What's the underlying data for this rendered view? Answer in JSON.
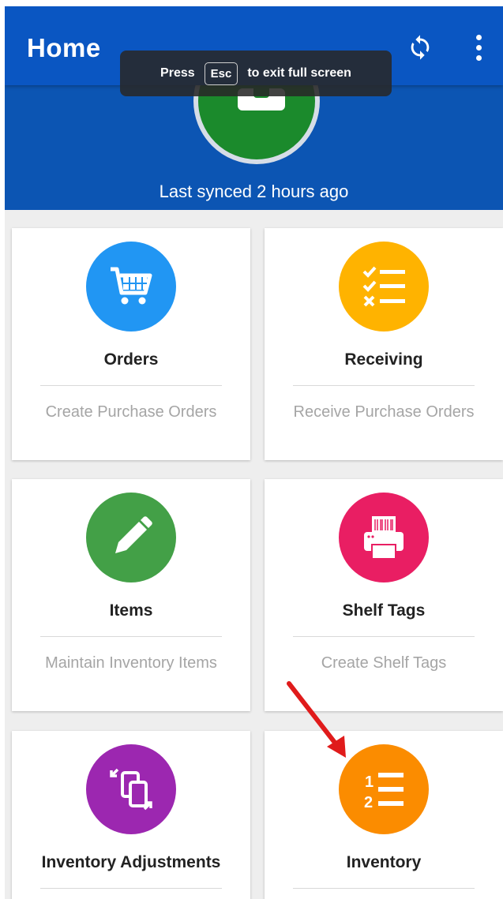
{
  "app": {
    "title": "Home",
    "sync_status": "Last synced 2 hours ago"
  },
  "toast": {
    "prefix": "Press",
    "key": "Esc",
    "suffix": "to exit full screen"
  },
  "tiles": [
    {
      "title": "Orders",
      "subtitle": "Create Purchase Orders",
      "icon": "cart-icon",
      "color": "#2196f3"
    },
    {
      "title": "Receiving",
      "subtitle": "Receive Purchase Orders",
      "icon": "checklist-icon",
      "color": "#ffb300"
    },
    {
      "title": "Items",
      "subtitle": "Maintain Inventory Items",
      "icon": "pencil-icon",
      "color": "#43a047"
    },
    {
      "title": "Shelf Tags",
      "subtitle": "Create Shelf Tags",
      "icon": "printer-icon",
      "color": "#e91e63"
    },
    {
      "title": "Inventory Adjustments",
      "subtitle": "",
      "icon": "swap-icon",
      "color": "#9c27b0"
    },
    {
      "title": "Inventory",
      "subtitle": "",
      "icon": "numbered-list-icon",
      "color": "#fb8c00"
    }
  ],
  "colors": {
    "header": "#0a56c2",
    "annotation_arrow": "#e01b1b"
  }
}
